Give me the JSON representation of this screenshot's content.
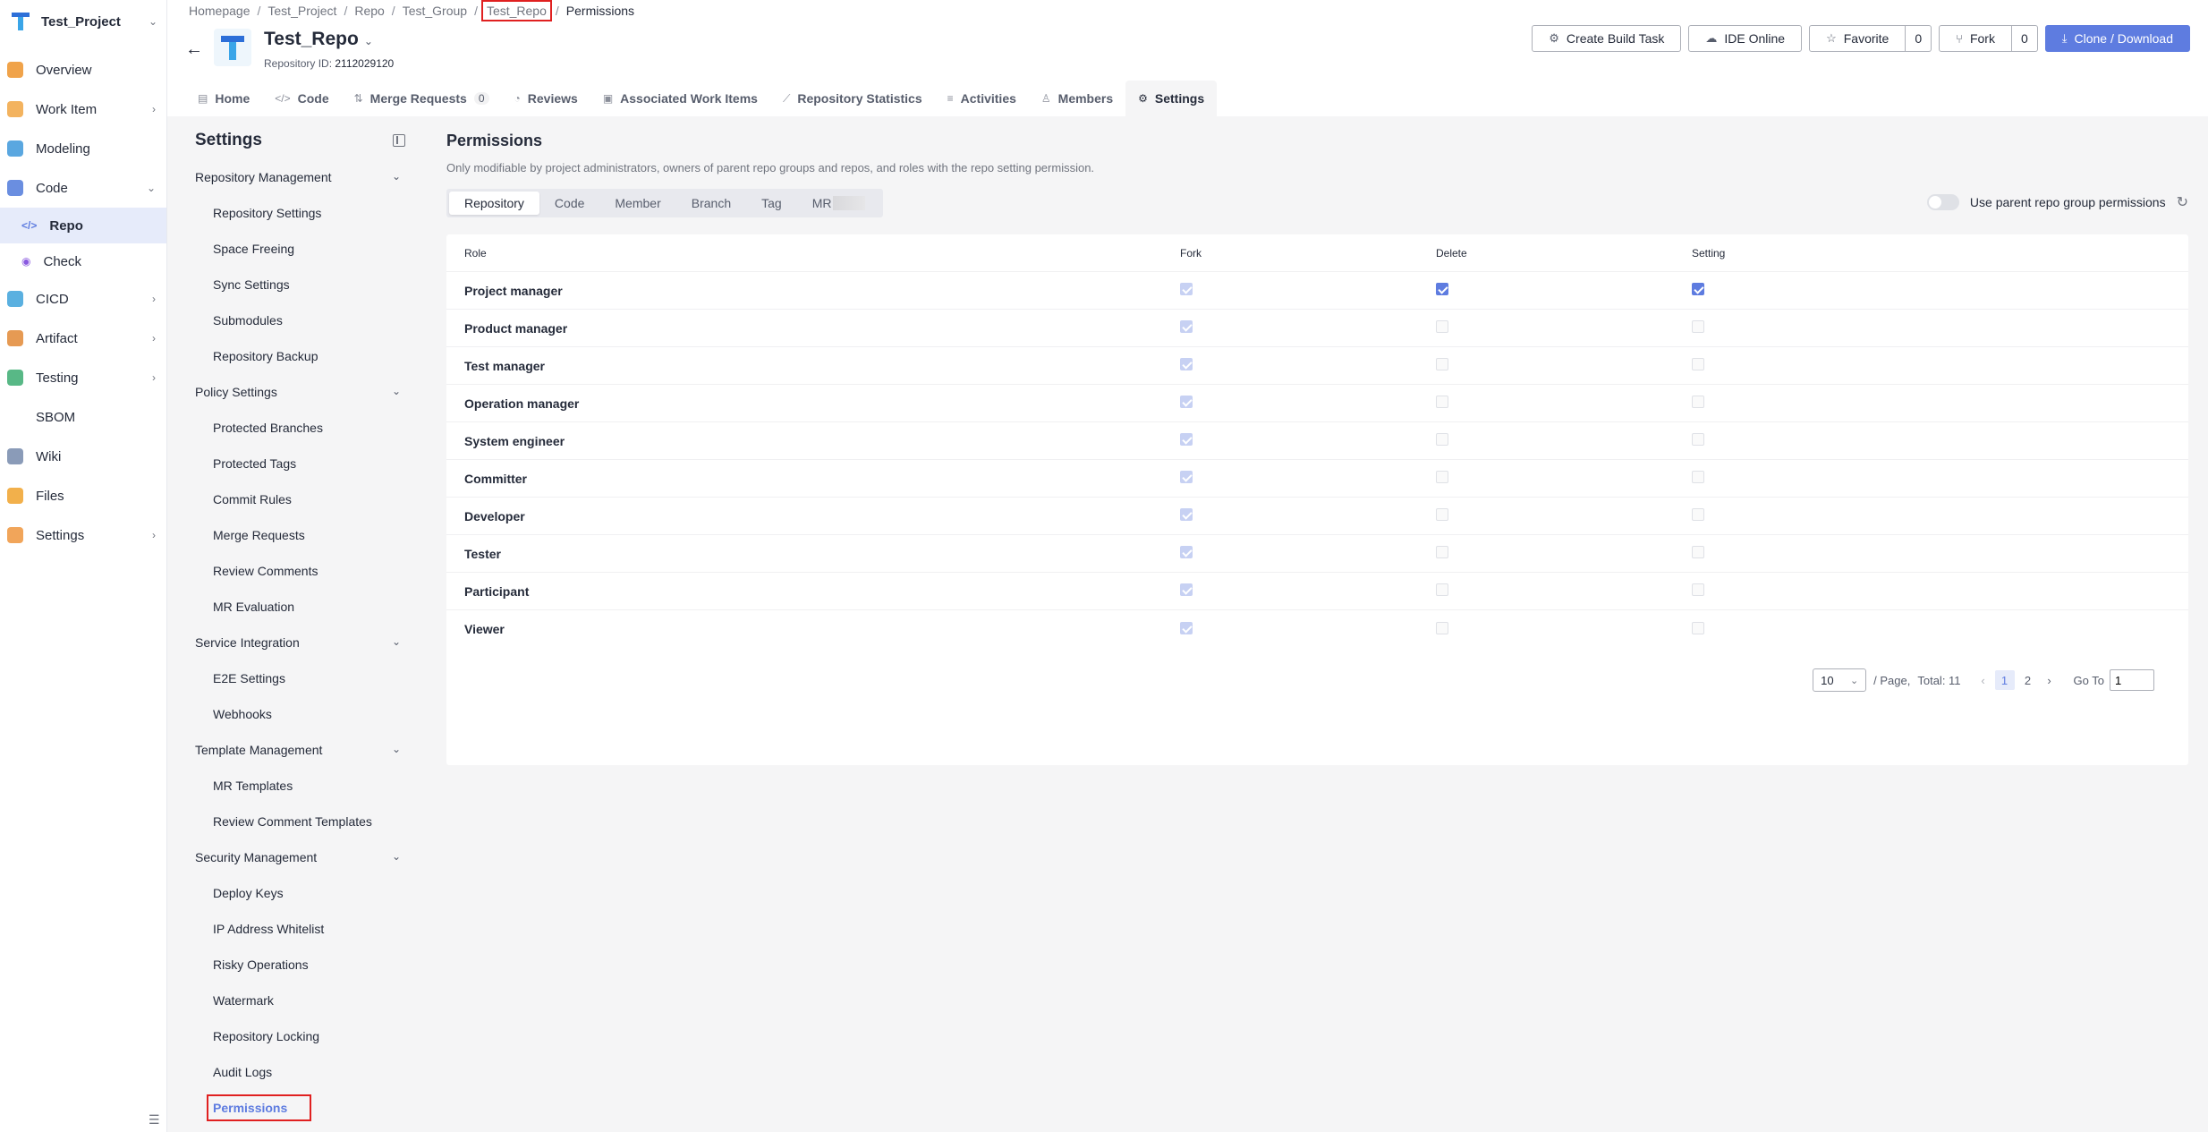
{
  "nav": {
    "project_name": "Test_Project",
    "items": [
      {
        "label": "Overview",
        "icon": "overview-icon",
        "color": "#f0a34a"
      },
      {
        "label": "Work Item",
        "icon": "work-item-icon",
        "color": "#f3b35f"
      },
      {
        "label": "Modeling",
        "icon": "modeling-icon",
        "color": "#5aa7e0"
      },
      {
        "label": "Code",
        "icon": "code-icon",
        "color": "#6a8ee0"
      },
      {
        "label": "CICD",
        "icon": "cicd-icon",
        "color": "#5ab0e0"
      },
      {
        "label": "Artifact",
        "icon": "artifact-icon",
        "color": "#e69a53"
      },
      {
        "label": "Testing",
        "icon": "testing-icon",
        "color": "#58b886"
      },
      {
        "label": "SBOM",
        "icon": "",
        "color": ""
      },
      {
        "label": "Wiki",
        "icon": "wiki-icon",
        "color": "#8a9bb8"
      },
      {
        "label": "Files",
        "icon": "files-icon",
        "color": "#f2b04b"
      },
      {
        "label": "Settings",
        "icon": "settings-icon",
        "color": "#f1a55a"
      }
    ],
    "code_sub": [
      {
        "label": "Repo"
      },
      {
        "label": "Check"
      }
    ]
  },
  "breadcrumb": [
    "Homepage",
    "Test_Project",
    "Repo",
    "Test_Group",
    "Test_Repo",
    "Permissions"
  ],
  "repo": {
    "name": "Test_Repo",
    "id_label": "Repository ID:",
    "id_value": "2112029120"
  },
  "actions": {
    "create_build": "Create Build Task",
    "ide_online": "IDE Online",
    "favorite": "Favorite",
    "favorite_count": "0",
    "fork": "Fork",
    "fork_count": "0",
    "clone": "Clone / Download"
  },
  "tabs": [
    {
      "label": "Home",
      "icon": "home-icon"
    },
    {
      "label": "Code",
      "icon": "code-tag-icon"
    },
    {
      "label": "Merge Requests",
      "icon": "merge-icon",
      "badge": "0"
    },
    {
      "label": "Reviews",
      "icon": "reviews-icon"
    },
    {
      "label": "Associated Work Items",
      "icon": "work-items-icon"
    },
    {
      "label": "Repository Statistics",
      "icon": "stats-icon"
    },
    {
      "label": "Activities",
      "icon": "activities-icon"
    },
    {
      "label": "Members",
      "icon": "members-icon"
    },
    {
      "label": "Settings",
      "icon": "gear-icon"
    }
  ],
  "settings_menu": {
    "title": "Settings",
    "groups": [
      {
        "label": "Repository Management",
        "items": [
          "Repository Settings",
          "Space Freeing",
          "Sync Settings",
          "Submodules",
          "Repository Backup"
        ]
      },
      {
        "label": "Policy Settings",
        "items": [
          "Protected Branches",
          "Protected Tags",
          "Commit Rules",
          "Merge Requests",
          "Review Comments",
          "MR Evaluation"
        ]
      },
      {
        "label": "Service Integration",
        "items": [
          "E2E Settings",
          "Webhooks"
        ]
      },
      {
        "label": "Template Management",
        "items": [
          "MR Templates",
          "Review Comment Templates"
        ]
      },
      {
        "label": "Security Management",
        "items": [
          "Deploy Keys",
          "IP Address Whitelist",
          "Risky Operations",
          "Watermark",
          "Repository Locking",
          "Audit Logs",
          "Permissions"
        ]
      }
    ]
  },
  "content": {
    "title": "Permissions",
    "description": "Only modifiable by project administrators, owners of parent repo groups and repos, and roles with the repo setting permission.",
    "subtabs": [
      "Repository",
      "Code",
      "Member",
      "Branch",
      "Tag",
      "MR"
    ],
    "parent_toggle_label": "Use parent repo group permissions",
    "columns": [
      "Role",
      "Fork",
      "Delete",
      "Setting"
    ],
    "rows": [
      {
        "role": "Project manager",
        "fork": true,
        "delete": true,
        "setting": true
      },
      {
        "role": "Product manager",
        "fork": true,
        "delete": false,
        "setting": false
      },
      {
        "role": "Test manager",
        "fork": true,
        "delete": false,
        "setting": false
      },
      {
        "role": "Operation manager",
        "fork": true,
        "delete": false,
        "setting": false
      },
      {
        "role": "System engineer",
        "fork": true,
        "delete": false,
        "setting": false
      },
      {
        "role": "Committer",
        "fork": true,
        "delete": false,
        "setting": false
      },
      {
        "role": "Developer",
        "fork": true,
        "delete": false,
        "setting": false
      },
      {
        "role": "Tester",
        "fork": true,
        "delete": false,
        "setting": false
      },
      {
        "role": "Participant",
        "fork": true,
        "delete": false,
        "setting": false
      },
      {
        "role": "Viewer",
        "fork": true,
        "delete": false,
        "setting": false
      }
    ]
  },
  "pager": {
    "page_size": "10",
    "per_page_label": "/ Page,",
    "total_label": "Total: 11",
    "pages": [
      "1",
      "2"
    ],
    "goto_label": "Go To",
    "goto_value": "1"
  },
  "colors": {
    "accent": "#5e7ce0",
    "highlight_box": "#e02020"
  }
}
